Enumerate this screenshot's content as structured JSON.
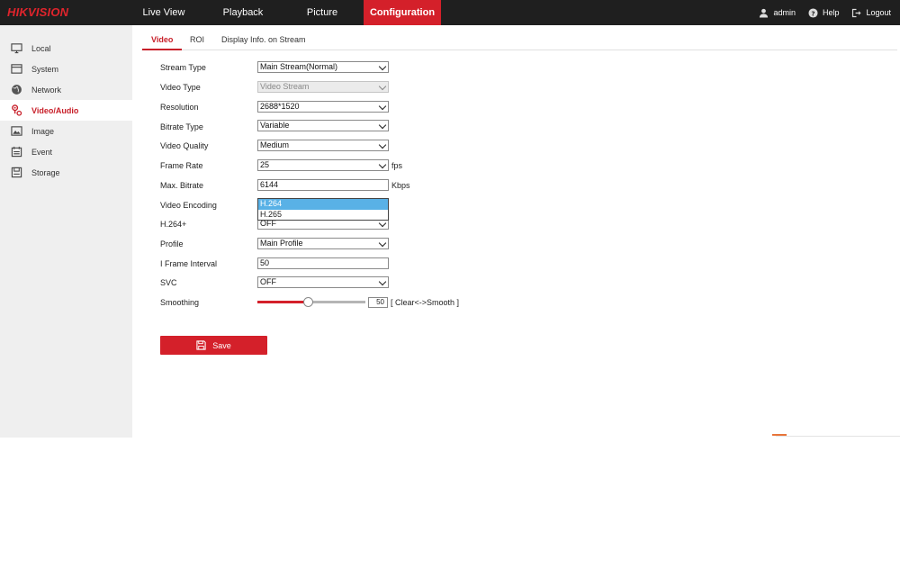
{
  "brand": {
    "logo_text": "HIKVISION",
    "accent": "#d4202a"
  },
  "nav": {
    "items": [
      {
        "label": "Live View"
      },
      {
        "label": "Playback"
      },
      {
        "label": "Picture"
      },
      {
        "label": "Configuration",
        "active": true
      }
    ]
  },
  "top_right": {
    "user": "admin",
    "help": "Help",
    "logout": "Logout",
    "icons": [
      "user-icon",
      "help-icon",
      "logout-icon"
    ]
  },
  "sidebar": {
    "items": [
      {
        "label": "Local",
        "icon": "monitor-icon"
      },
      {
        "label": "System",
        "icon": "system-icon"
      },
      {
        "label": "Network",
        "icon": "globe-icon"
      },
      {
        "label": "Video/Audio",
        "icon": "video-audio-icon",
        "active": true
      },
      {
        "label": "Image",
        "icon": "image-icon"
      },
      {
        "label": "Event",
        "icon": "calendar-icon"
      },
      {
        "label": "Storage",
        "icon": "storage-icon"
      }
    ]
  },
  "tabs": [
    {
      "label": "Video",
      "active": true
    },
    {
      "label": "ROI"
    },
    {
      "label": "Display Info. on Stream"
    }
  ],
  "form": {
    "stream_type": {
      "label": "Stream Type",
      "value": "Main Stream(Normal)"
    },
    "video_type": {
      "label": "Video Type",
      "value": "Video Stream"
    },
    "resolution": {
      "label": "Resolution",
      "value": "2688*1520"
    },
    "bitrate_type": {
      "label": "Bitrate Type",
      "value": "Variable"
    },
    "video_quality": {
      "label": "Video Quality",
      "value": "Medium"
    },
    "frame_rate": {
      "label": "Frame Rate",
      "value": "25",
      "unit": "fps"
    },
    "max_bitrate": {
      "label": "Max. Bitrate",
      "value": "6144",
      "unit": "Kbps"
    },
    "video_encoding": {
      "label": "Video Encoding",
      "options": [
        "H.264",
        "H.265"
      ],
      "selected": "H.264"
    },
    "h264plus": {
      "label": "H.264+",
      "value": "OFF"
    },
    "profile": {
      "label": "Profile",
      "value": "Main Profile"
    },
    "i_frame_interval": {
      "label": "I Frame Interval",
      "value": "50"
    },
    "svc": {
      "label": "SVC",
      "value": "OFF"
    },
    "smoothing": {
      "label": "Smoothing",
      "value": "50",
      "hint": "[ Clear<->Smooth ]",
      "level_percent": 50
    }
  },
  "save": {
    "label": "Save",
    "icon": "floppy-disk-icon"
  }
}
